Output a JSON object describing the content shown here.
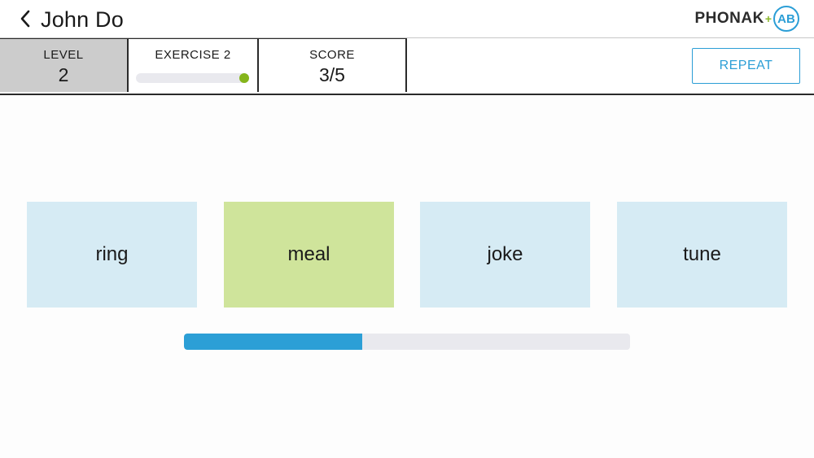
{
  "header": {
    "back_icon": "chevron-left-icon",
    "title": "John Do",
    "logo": {
      "word": "PHONAK",
      "plus": "+",
      "badge": "AB"
    }
  },
  "status": {
    "level": {
      "label": "LEVEL",
      "value": "2"
    },
    "exercise": {
      "label": "EXERCISE 2",
      "progress": 1.0
    },
    "score": {
      "label": "SCORE",
      "value": "3/5"
    }
  },
  "repeat_label": "REPEAT",
  "choices": [
    {
      "word": "ring",
      "selected": false
    },
    {
      "word": "meal",
      "selected": true
    },
    {
      "word": "joke",
      "selected": false
    },
    {
      "word": "tune",
      "selected": false
    }
  ],
  "audio_progress": 0.4,
  "colors": {
    "accent_blue": "#2c9fd6",
    "accent_green": "#85b51b",
    "card_default": "#d6ebf4",
    "card_selected": "#cfe49b",
    "level_cell": "#cccccc"
  }
}
